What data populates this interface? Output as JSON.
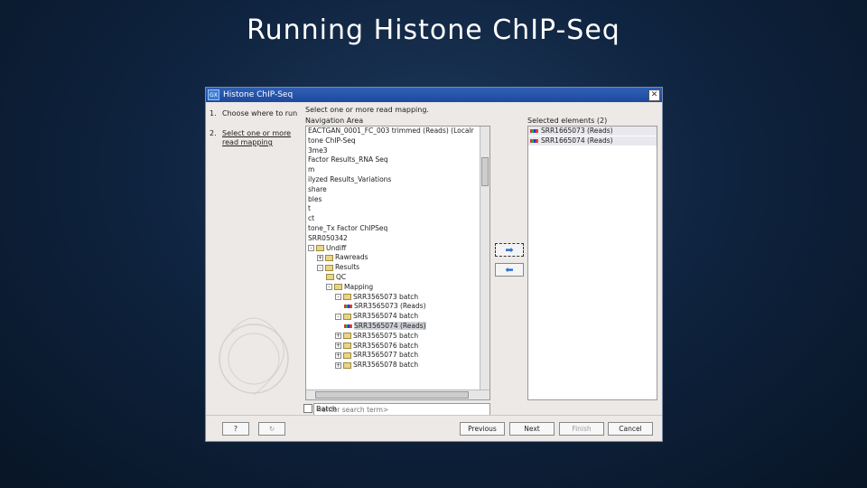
{
  "slide": {
    "title": "Running Histone ChIP-Seq"
  },
  "window": {
    "title": "Histone ChIP-Seq",
    "app_icon": "GX"
  },
  "steps": [
    {
      "num": "1.",
      "label": "Choose where to run"
    },
    {
      "num": "2.",
      "label": "Select one or more read mapping"
    }
  ],
  "main": {
    "instruction": "Select one or more read mapping.",
    "navigation_label": "Navigation Area",
    "selected_label": "Selected elements (2)"
  },
  "tree": [
    {
      "label": "EACTGAN_0001_FC_003 trimmed (Reads) (Localr",
      "indent": 0,
      "icon": ""
    },
    {
      "label": "tone ChIP-Seq",
      "indent": 0,
      "icon": ""
    },
    {
      "label": "3me3",
      "indent": 0,
      "icon": ""
    },
    {
      "label": "Factor Results_RNA Seq",
      "indent": 0,
      "icon": ""
    },
    {
      "label": "m",
      "indent": 0,
      "icon": ""
    },
    {
      "label": "ilyzed Results_Variations",
      "indent": 0,
      "icon": ""
    },
    {
      "label": "share",
      "indent": 0,
      "icon": ""
    },
    {
      "label": "bles",
      "indent": 0,
      "icon": ""
    },
    {
      "label": "t",
      "indent": 0,
      "icon": ""
    },
    {
      "label": "ct",
      "indent": 0,
      "icon": ""
    },
    {
      "label": "tone_Tx Factor ChIPSeq",
      "indent": 0,
      "icon": ""
    },
    {
      "label": "SRR050342",
      "indent": 0,
      "icon": ""
    },
    {
      "label": "Undiff",
      "indent": 0,
      "icon": "folder",
      "exp": "-"
    },
    {
      "label": "Rawreads",
      "indent": 1,
      "icon": "folder",
      "exp": "+"
    },
    {
      "label": "Results",
      "indent": 1,
      "icon": "folder",
      "exp": "-"
    },
    {
      "label": "QC",
      "indent": 2,
      "icon": "folder",
      "exp": ""
    },
    {
      "label": "Mapping",
      "indent": 2,
      "icon": "folder",
      "exp": "-"
    },
    {
      "label": "SRR3565073 batch",
      "indent": 3,
      "icon": "folder",
      "exp": "-"
    },
    {
      "label": "SRR3565073 (Reads)",
      "indent": 4,
      "icon": "reads",
      "exp": ""
    },
    {
      "label": "SRR3565074 batch",
      "indent": 3,
      "icon": "folder",
      "exp": "-"
    },
    {
      "label": "SRR3565074 (Reads)",
      "indent": 4,
      "icon": "reads",
      "exp": "",
      "selected": true
    },
    {
      "label": "SRR3565075 batch",
      "indent": 3,
      "icon": "folder",
      "exp": "+"
    },
    {
      "label": "SRR3565076 batch",
      "indent": 3,
      "icon": "folder",
      "exp": "+"
    },
    {
      "label": "SRR3565077 batch",
      "indent": 3,
      "icon": "folder",
      "exp": "+"
    },
    {
      "label": "SRR3565078 batch",
      "indent": 3,
      "icon": "folder",
      "exp": "+"
    }
  ],
  "selected": [
    {
      "label": "SRR1665073 (Reads)"
    },
    {
      "label": "SRR1665074 (Reads)"
    }
  ],
  "arrows": {
    "add": "➡",
    "remove": "⬅"
  },
  "search": {
    "placeholder": "<enter search term>",
    "icon": "Q"
  },
  "batch_label": "Batch",
  "buttons": {
    "help": "?",
    "reset": "↻",
    "previous": "Previous",
    "next": "Next",
    "finish": "Finish",
    "cancel": "Cancel"
  }
}
